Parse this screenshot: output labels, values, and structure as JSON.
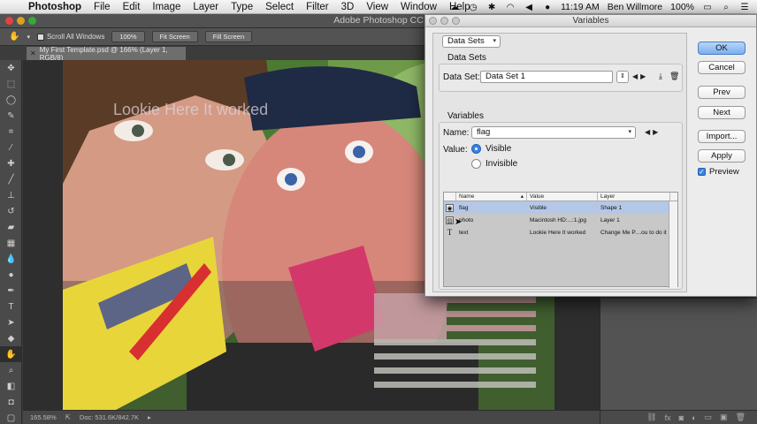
{
  "menubar": {
    "app_name": "Photoshop",
    "items": [
      "File",
      "Edit",
      "Image",
      "Layer",
      "Type",
      "Select",
      "Filter",
      "3D",
      "View",
      "Window",
      "Help"
    ],
    "clock": "11:19 AM",
    "user": "Ben Willmore",
    "battery": "100%"
  },
  "ps_window": {
    "title": "Adobe Photoshop CC"
  },
  "options_bar": {
    "scroll_all": "Scroll All Windows",
    "btn_100": "100%",
    "btn_fit": "Fit Screen",
    "btn_fill": "Fill Screen"
  },
  "document": {
    "tab_title": "My First Template.psd @ 166% (Layer 1, RGB/8)",
    "overlay_text": "Lookie Here It worked"
  },
  "status_bar": {
    "zoom": "165.58%",
    "doc_info": "Doc: 531.6K/842.7K"
  },
  "dialog": {
    "title": "Variables",
    "mode_select": "Data Sets",
    "data_sets_group": "Data Sets",
    "data_set_label": "Data Set:",
    "data_set_value": "Data Set 1",
    "variables_group": "Variables",
    "name_label": "Name:",
    "name_value": "flag",
    "value_label": "Value:",
    "radio_visible": "Visible",
    "radio_invisible": "Invisible",
    "table": {
      "headers": [
        "Name",
        "Value",
        "Layer"
      ],
      "rows": [
        {
          "icon": "visibility-icon",
          "name": "flag",
          "value": "Visible",
          "layer": "Shape 1"
        },
        {
          "icon": "image-icon",
          "name": "photo",
          "value": "Macintosh HD:...:1.jpg",
          "layer": "Layer 1"
        },
        {
          "icon": "text-icon",
          "name": "text",
          "value": "Lookie Here It worked",
          "layer": "Change Me P....ou to do it"
        }
      ]
    },
    "buttons": {
      "ok": "OK",
      "cancel": "Cancel",
      "prev": "Prev",
      "next": "Next",
      "import": "Import...",
      "apply": "Apply"
    },
    "preview_label": "Preview",
    "preview_checked": true
  },
  "colors": {
    "primary_button": "#7aaff0",
    "selected_row": "#b4c8e6",
    "ps_ui": "#535353"
  }
}
